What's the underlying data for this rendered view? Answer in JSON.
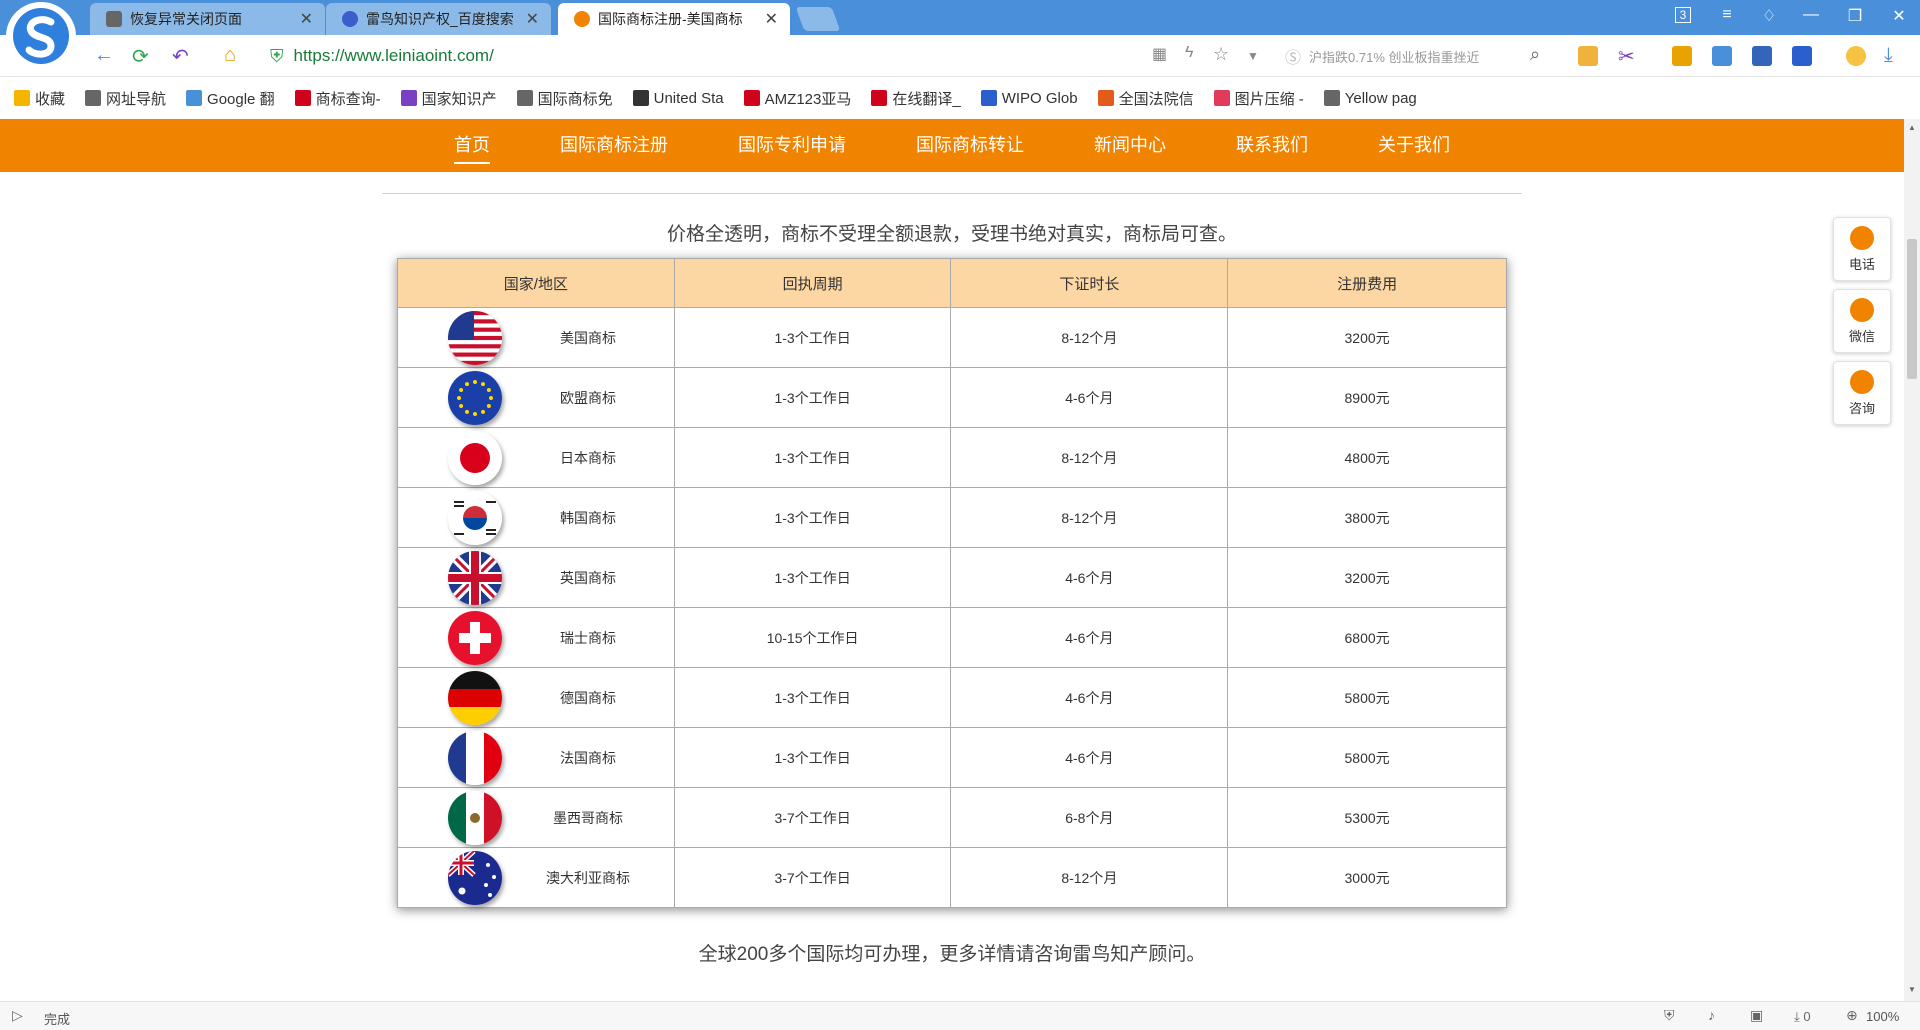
{
  "browser": {
    "tabs": [
      {
        "title": "恢复异常关闭页面",
        "active": false
      },
      {
        "title": "雷鸟知识产权_百度搜索",
        "active": false
      },
      {
        "title": "国际商标注册-美国商标",
        "active": true
      }
    ],
    "url": "https://www.leiniaoint.com/",
    "search_text": "沪指跌0.71% 创业板指重挫近",
    "tab_count": "3",
    "bookmarks": [
      {
        "label": "收藏",
        "icon": "star-icon"
      },
      {
        "label": "网址导航",
        "icon": "globe-icon"
      },
      {
        "label": "Google 翻",
        "icon": "translate-icon"
      },
      {
        "label": "商标查询-",
        "icon": "k-icon"
      },
      {
        "label": "国家知识产",
        "icon": "ip-icon"
      },
      {
        "label": "国际商标免",
        "icon": "doc-icon"
      },
      {
        "label": "United Sta",
        "icon": "uspto-icon"
      },
      {
        "label": "AMZ123亚马",
        "icon": "amz-icon"
      },
      {
        "label": "在线翻译_",
        "icon": "youdao-icon"
      },
      {
        "label": "WIPO Glob",
        "icon": "wipo-icon"
      },
      {
        "label": "全国法院信",
        "icon": "court-icon"
      },
      {
        "label": "图片压缩 -",
        "icon": "compress-icon"
      },
      {
        "label": "Yellow pag",
        "icon": "doc-icon"
      }
    ],
    "status": "完成",
    "zoom": "100%",
    "download_count": "0"
  },
  "page": {
    "nav": [
      {
        "label": "首页",
        "active": true
      },
      {
        "label": "国际商标注册",
        "active": false
      },
      {
        "label": "国际专利申请",
        "active": false
      },
      {
        "label": "国际商标转让",
        "active": false
      },
      {
        "label": "新闻中心",
        "active": false
      },
      {
        "label": "联系我们",
        "active": false
      },
      {
        "label": "关于我们",
        "active": false
      }
    ],
    "intro": "价格全透明，商标不受理全额退款，受理书绝对真实，商标局可查。",
    "table": {
      "headers": [
        "国家/地区",
        "回执周期",
        "下证时长",
        "注册费用"
      ],
      "rows": [
        {
          "flag": "us",
          "country": "美国商标",
          "cycle": "1-3个工作日",
          "duration": "8-12个月",
          "fee": "3200元"
        },
        {
          "flag": "eu",
          "country": "欧盟商标",
          "cycle": "1-3个工作日",
          "duration": "4-6个月",
          "fee": "8900元"
        },
        {
          "flag": "jp",
          "country": "日本商标",
          "cycle": "1-3个工作日",
          "duration": "8-12个月",
          "fee": "4800元"
        },
        {
          "flag": "kr",
          "country": "韩国商标",
          "cycle": "1-3个工作日",
          "duration": "8-12个月",
          "fee": "3800元"
        },
        {
          "flag": "gb",
          "country": "英国商标",
          "cycle": "1-3个工作日",
          "duration": "4-6个月",
          "fee": "3200元"
        },
        {
          "flag": "ch",
          "country": "瑞士商标",
          "cycle": "10-15个工作日",
          "duration": "4-6个月",
          "fee": "6800元"
        },
        {
          "flag": "de",
          "country": "德国商标",
          "cycle": "1-3个工作日",
          "duration": "4-6个月",
          "fee": "5800元"
        },
        {
          "flag": "fr",
          "country": "法国商标",
          "cycle": "1-3个工作日",
          "duration": "4-6个月",
          "fee": "5800元"
        },
        {
          "flag": "mx",
          "country": "墨西哥商标",
          "cycle": "3-7个工作日",
          "duration": "6-8个月",
          "fee": "5300元"
        },
        {
          "flag": "au",
          "country": "澳大利亚商标",
          "cycle": "3-7个工作日",
          "duration": "8-12个月",
          "fee": "3000元"
        }
      ]
    },
    "outro": "全球200多个国际均可办理，更多详情请咨询雷鸟知产顾问。",
    "side_tools": [
      {
        "label": "电话",
        "icon": "phone-icon"
      },
      {
        "label": "微信",
        "icon": "wechat-icon"
      },
      {
        "label": "咨询",
        "icon": "consult-icon"
      }
    ]
  },
  "colors": {
    "nav_bg": "#f08300",
    "table_header_bg": "#fcd7a4",
    "browser_blue": "#4a8fd9",
    "url_green": "#1a7a3a"
  }
}
